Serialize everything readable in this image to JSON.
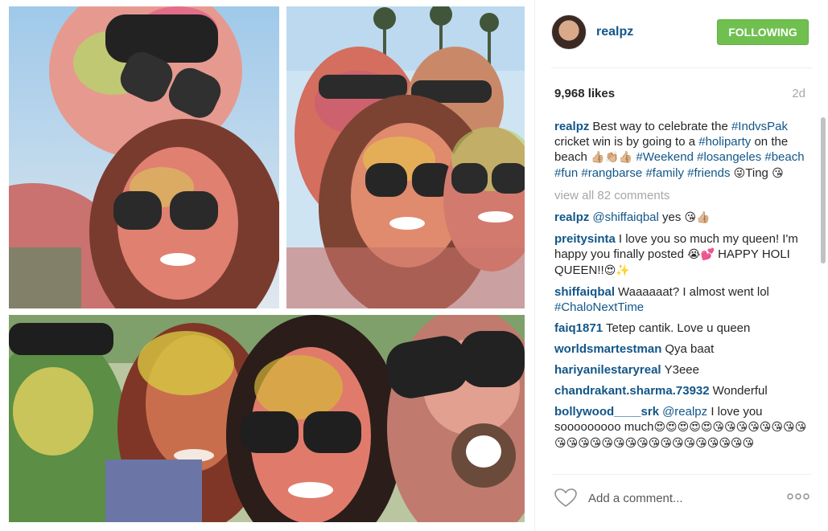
{
  "post": {
    "username": "realpz",
    "follow_label": "FOLLOWING",
    "likes": "9,968 likes",
    "age": "2d",
    "caption": {
      "user": "realpz",
      "parts": [
        {
          "t": "text",
          "v": "Best way to celebrate the "
        },
        {
          "t": "tag",
          "v": "#IndvsPak"
        },
        {
          "t": "text",
          "v": " cricket win is by going to a "
        },
        {
          "t": "tag",
          "v": "#holiparty"
        },
        {
          "t": "text",
          "v": " on the beach "
        },
        {
          "t": "emoji",
          "v": "👍🏼👏🏼👍🏼"
        },
        {
          "t": "text",
          "v": " "
        },
        {
          "t": "tag",
          "v": "#Weekend"
        },
        {
          "t": "text",
          "v": " "
        },
        {
          "t": "tag",
          "v": "#losangeles"
        },
        {
          "t": "text",
          "v": " "
        },
        {
          "t": "tag",
          "v": "#beach"
        },
        {
          "t": "text",
          "v": " "
        },
        {
          "t": "tag",
          "v": "#fun"
        },
        {
          "t": "text",
          "v": " "
        },
        {
          "t": "tag",
          "v": "#rangbarse"
        },
        {
          "t": "text",
          "v": " "
        },
        {
          "t": "tag",
          "v": "#family"
        },
        {
          "t": "text",
          "v": " "
        },
        {
          "t": "tag",
          "v": "#friends"
        },
        {
          "t": "text",
          "v": " "
        },
        {
          "t": "emoji",
          "v": "😜"
        },
        {
          "t": "text",
          "v": "Ting "
        },
        {
          "t": "emoji",
          "v": "😘"
        }
      ]
    },
    "view_all": "view all 82 comments",
    "comments": [
      {
        "user": "realpz",
        "parts": [
          {
            "t": "tag",
            "v": "@shiffaiqbal"
          },
          {
            "t": "text",
            "v": " yes "
          },
          {
            "t": "emoji",
            "v": "😘👍🏼"
          }
        ]
      },
      {
        "user": "preitysinta",
        "parts": [
          {
            "t": "text",
            "v": "I love you so much my queen! I'm happy you finally posted "
          },
          {
            "t": "emoji",
            "v": "😭💕"
          },
          {
            "t": "text",
            "v": " HAPPY HOLI QUEEN!!"
          },
          {
            "t": "emoji",
            "v": "😍✨"
          }
        ]
      },
      {
        "user": "shiffaiqbal",
        "parts": [
          {
            "t": "text",
            "v": "Waaaaaat? I almost went lol "
          },
          {
            "t": "tag",
            "v": "#ChaloNextTime"
          }
        ]
      },
      {
        "user": "faiq1871",
        "parts": [
          {
            "t": "text",
            "v": "Tetep cantik. Love u queen"
          }
        ]
      },
      {
        "user": "worldsmartestman",
        "parts": [
          {
            "t": "text",
            "v": "Qya baat"
          }
        ]
      },
      {
        "user": "hariyanilestaryreal",
        "parts": [
          {
            "t": "text",
            "v": "Y3eee"
          }
        ]
      },
      {
        "user": "chandrakant.sharma.73932",
        "parts": [
          {
            "t": "text",
            "v": "Wonderful"
          }
        ]
      },
      {
        "user": "bollywood____srk",
        "parts": [
          {
            "t": "tag",
            "v": "@realpz"
          },
          {
            "t": "text",
            "v": " I love you sooooooooo much"
          },
          {
            "t": "emoji",
            "v": "😍😍😍😍😍😘😘😘😘😘😘😘😘😘😘😘😘😘😘😘😘😘😘😘😘😘😘😘😘😘"
          }
        ]
      }
    ],
    "add_comment_placeholder": "Add a comment...",
    "icons": {
      "heart": "heart-icon",
      "more": "more-options-icon"
    }
  },
  "colors": {
    "link": "#125688",
    "follow_bg": "#70c050",
    "muted": "#a5a7aa"
  }
}
